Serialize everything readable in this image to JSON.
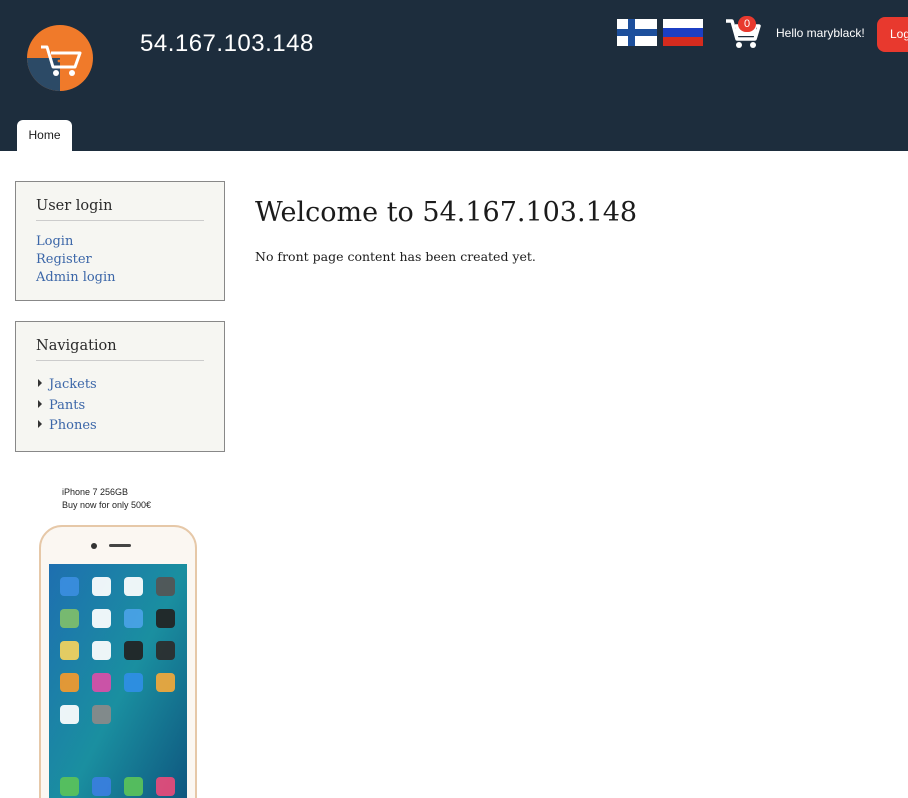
{
  "header": {
    "site_name": "54.167.103.148",
    "cart_count": "0",
    "greeting": "Hello maryblack!",
    "logout_label": "Log out",
    "languages": [
      "Finnish",
      "Russian"
    ]
  },
  "tabs": [
    {
      "label": "Home"
    }
  ],
  "sidebar": {
    "user_login": {
      "title": "User login",
      "links": [
        "Login",
        "Register",
        "Admin login"
      ]
    },
    "navigation": {
      "title": "Navigation",
      "items": [
        "Jackets",
        "Pants",
        "Phones"
      ]
    },
    "ad": {
      "line1": "iPhone 7 256GB",
      "line2": "Buy now for only 500€"
    }
  },
  "main": {
    "title": "Welcome to 54.167.103.148",
    "body": "No front page content has been created yet."
  },
  "colors": {
    "header_bg": "#1d2d3d",
    "accent_red": "#e8392e",
    "logo_orange": "#f07a2a",
    "logo_blue": "#2c4a66",
    "link": "#3b66a8"
  }
}
